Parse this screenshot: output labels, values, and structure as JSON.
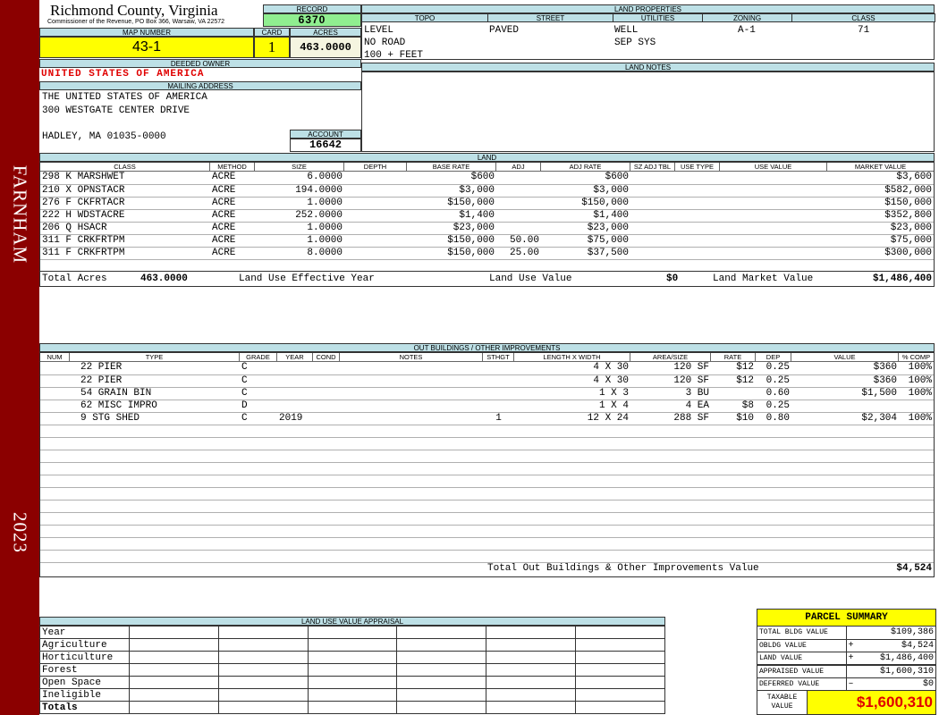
{
  "sidebar": {
    "top_text": "FARNHAM",
    "bottom_text": "2023",
    "color": "#8b0000"
  },
  "header": {
    "county": "Richmond County, Virginia",
    "commissioner": "Commissioner of the Revenue, PO Box 366, Warsaw, VA 22572",
    "record_label": "RECORD",
    "record_value": "6370",
    "map_label": "MAP NUMBER",
    "map_value": "43-1",
    "card_label": "CARD",
    "card_value": "1",
    "acres_label": "ACRES",
    "acres_value": "463.0000"
  },
  "land_properties": {
    "title": "LAND PROPERTIES",
    "topo_label": "TOPO",
    "street_label": "STREET",
    "utilities_label": "UTILITIES",
    "zoning_label": "ZONING",
    "class_label": "CLASS",
    "topo": [
      "LEVEL",
      "NO ROAD",
      "100 + FEET"
    ],
    "street": "PAVED",
    "utilities": [
      "WELL",
      "SEP SYS"
    ],
    "zoning": "A-1",
    "class": "71"
  },
  "owner": {
    "deeded_label": "DEEDED OWNER",
    "deeded_owner": "UNITED STATES OF AMERICA",
    "mailing_label": "MAILING ADDRESS",
    "address1": "THE UNITED STATES OF AMERICA",
    "address2": "300 WESTGATE CENTER DRIVE",
    "address3": "HADLEY, MA 01035-0000",
    "account_label": "ACCOUNT",
    "account_value": "16642"
  },
  "land_notes": {
    "title": "LAND NOTES"
  },
  "land": {
    "title": "LAND",
    "columns": [
      "CLASS",
      "METHOD",
      "SIZE",
      "DEPTH",
      "BASE RATE",
      "ADJ",
      "ADJ RATE",
      "SZ ADJ TBL",
      "USE TYPE",
      "USE VALUE",
      "MARKET VALUE"
    ],
    "rows": [
      {
        "class": "298 K MARSHWET",
        "method": "ACRE",
        "size": "6.0000",
        "depth": "",
        "base": "$600",
        "adj": "",
        "adj_rate": "$600",
        "market": "$3,600"
      },
      {
        "class": "210 X OPNSTACR",
        "method": "ACRE",
        "size": "194.0000",
        "depth": "",
        "base": "$3,000",
        "adj": "",
        "adj_rate": "$3,000",
        "market": "$582,000"
      },
      {
        "class": "276 F CKFRTACR",
        "method": "ACRE",
        "size": "1.0000",
        "depth": "",
        "base": "$150,000",
        "adj": "",
        "adj_rate": "$150,000",
        "market": "$150,000"
      },
      {
        "class": "222 H WDSTACRE",
        "method": "ACRE",
        "size": "252.0000",
        "depth": "",
        "base": "$1,400",
        "adj": "",
        "adj_rate": "$1,400",
        "market": "$352,800"
      },
      {
        "class": "206 Q HSACR",
        "method": "ACRE",
        "size": "1.0000",
        "depth": "",
        "base": "$23,000",
        "adj": "",
        "adj_rate": "$23,000",
        "market": "$23,000"
      },
      {
        "class": "311 F CRKFRTPM",
        "method": "ACRE",
        "size": "1.0000",
        "depth": "",
        "base": "$150,000",
        "adj": "50.00",
        "adj_rate": "$75,000",
        "market": "$75,000"
      },
      {
        "class": "311 F CRKFRTPM",
        "method": "ACRE",
        "size": "8.0000",
        "depth": "",
        "base": "$150,000",
        "adj": "25.00",
        "adj_rate": "$37,500",
        "market": "$300,000"
      }
    ],
    "totals": {
      "acres_label": "Total Acres",
      "acres": "463.0000",
      "year_label": "Land Use Effective Year",
      "use_label": "Land Use Value",
      "use_value": "$0",
      "market_label": "Land Market Value",
      "market_value": "$1,486,400"
    }
  },
  "outbuildings": {
    "title": "OUT BUILDINGS / OTHER IMPROVEMENTS",
    "columns": [
      "NUM",
      "TYPE",
      "GRADE",
      "YEAR",
      "COND",
      "NOTES",
      "STHGT",
      "LENGTH X WIDTH",
      "AREA/SIZE",
      "RATE",
      "DEP",
      "VALUE",
      "% COMP"
    ],
    "rows": [
      {
        "type": "22 PIER",
        "grade": "C",
        "year": "",
        "sthgt": "",
        "lw": "4 X 30",
        "area": "120 SF",
        "rate": "$12",
        "dep": "0.25",
        "value": "$360",
        "comp": "100%"
      },
      {
        "type": "22 PIER",
        "grade": "C",
        "year": "",
        "sthgt": "",
        "lw": "4 X 30",
        "area": "120 SF",
        "rate": "$12",
        "dep": "0.25",
        "value": "$360",
        "comp": "100%"
      },
      {
        "type": "54 GRAIN BIN",
        "grade": "C",
        "year": "",
        "sthgt": "",
        "lw": "1 X 3",
        "area": "3 BU",
        "rate": "",
        "dep": "0.60",
        "value": "$1,500",
        "comp": "100%"
      },
      {
        "type": "62 MISC IMPRO",
        "grade": "D",
        "year": "",
        "sthgt": "",
        "lw": "1 X 4",
        "area": "4 EA",
        "rate": "$8",
        "dep": "0.25",
        "value": "",
        "comp": ""
      },
      {
        "type": "9 STG SHED",
        "grade": "C",
        "year": "2019",
        "sthgt": "1",
        "lw": "12 X 24",
        "area": "288 SF",
        "rate": "$10",
        "dep": "0.80",
        "value": "$2,304",
        "comp": "100%"
      }
    ],
    "total_label": "Total Out Buildings & Other Improvements Value",
    "total_value": "$4,524"
  },
  "land_use_appraisal": {
    "title": "LAND USE VALUE APPRAISAL",
    "rows": [
      "Year",
      "Agriculture",
      "Horticulture",
      "Forest",
      "Open Space",
      "Ineligible",
      "Totals"
    ]
  },
  "parcel_summary": {
    "title": "PARCEL SUMMARY",
    "bldg_label": "TOTAL BLDG VALUE",
    "bldg": "$109,386",
    "obldg_label": "OBLDG VALUE",
    "obldg_sign": "+",
    "obldg": "$4,524",
    "land_label": "LAND VALUE",
    "land_sign": "+",
    "land": "$1,486,400",
    "appraised_label": "APPRAISED VALUE",
    "appraised": "$1,600,310",
    "deferred_label": "DEFERRED VALUE",
    "deferred_sign": "–",
    "deferred": "$0",
    "taxable_label": "TAXABLE VALUE",
    "taxable": "$1,600,310"
  },
  "colors": {
    "header_bg": "#bde0e6",
    "highlight": "#ffff00",
    "record_bg": "#90ee90",
    "owner_red": "#e00000"
  }
}
